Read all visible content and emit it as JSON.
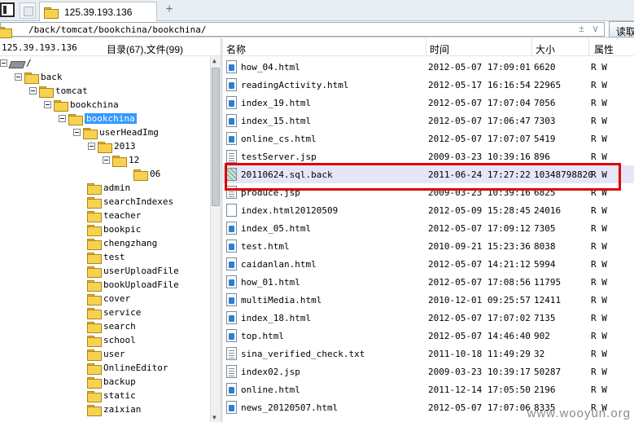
{
  "tab": {
    "title": "125.39.193.136"
  },
  "address": {
    "path": "/back/tomcat/bookchina/bookchina/",
    "read_label": "读取"
  },
  "left_header": {
    "host": "125.39.193.136",
    "counts": "目录(67),文件(99)"
  },
  "tree": [
    {
      "name": "/",
      "kind": "drive"
    },
    {
      "name": "back",
      "kind": "folder"
    },
    {
      "name": "tomcat",
      "kind": "folder"
    },
    {
      "name": "bookchina",
      "kind": "folder"
    },
    {
      "name": "bookchina",
      "kind": "folder",
      "selected": true
    },
    {
      "name": "userHeadImg",
      "kind": "folder"
    },
    {
      "name": "2013",
      "kind": "folder"
    },
    {
      "name": "12",
      "kind": "folder"
    },
    {
      "name": "06",
      "kind": "folder"
    },
    {
      "name": "admin",
      "kind": "folder"
    },
    {
      "name": "searchIndexes",
      "kind": "folder"
    },
    {
      "name": "teacher",
      "kind": "folder"
    },
    {
      "name": "bookpic",
      "kind": "folder"
    },
    {
      "name": "chengzhang",
      "kind": "folder"
    },
    {
      "name": "test",
      "kind": "folder"
    },
    {
      "name": "userUploadFile",
      "kind": "folder"
    },
    {
      "name": "bookUploadFile",
      "kind": "folder"
    },
    {
      "name": "cover",
      "kind": "folder"
    },
    {
      "name": "service",
      "kind": "folder"
    },
    {
      "name": "search",
      "kind": "folder"
    },
    {
      "name": "school",
      "kind": "folder"
    },
    {
      "name": "user",
      "kind": "folder"
    },
    {
      "name": "OnlineEditor",
      "kind": "folder"
    },
    {
      "name": "backup",
      "kind": "folder"
    },
    {
      "name": "static",
      "kind": "folder"
    },
    {
      "name": "zaixian",
      "kind": "folder"
    }
  ],
  "columns": {
    "name": "名称",
    "time": "时间",
    "size": "大小",
    "attr": "属性"
  },
  "files": [
    {
      "name": "how_04.html",
      "time": "2012-05-07 17:09:01",
      "size": "6620",
      "attr": "R W",
      "icon": "doc"
    },
    {
      "name": "readingActivity.html",
      "time": "2012-05-17 16:16:54",
      "size": "22965",
      "attr": "R W",
      "icon": "doc"
    },
    {
      "name": "index_19.html",
      "time": "2012-05-07 17:07:04",
      "size": "7056",
      "attr": "R W",
      "icon": "doc"
    },
    {
      "name": "index_15.html",
      "time": "2012-05-07 17:06:47",
      "size": "7303",
      "attr": "R W",
      "icon": "doc"
    },
    {
      "name": "online_cs.html",
      "time": "2012-05-07 17:07:07",
      "size": "5419",
      "attr": "R W",
      "icon": "doc"
    },
    {
      "name": "testServer.jsp",
      "time": "2009-03-23 10:39:16",
      "size": "896",
      "attr": "R W",
      "icon": "txt"
    },
    {
      "name": "20110624.sql.back",
      "time": "2011-06-24 17:27:22",
      "size": "10348798820",
      "attr": "R W",
      "icon": "bak",
      "highlight": true
    },
    {
      "name": "produce.jsp",
      "time": "2009-03-23 10:39:16",
      "size": "6825",
      "attr": "R W",
      "icon": "txt"
    },
    {
      "name": "index.html20120509",
      "time": "2012-05-09 15:28:45",
      "size": "24016",
      "attr": "R W",
      "icon": "plain"
    },
    {
      "name": "index_05.html",
      "time": "2012-05-07 17:09:12",
      "size": "7305",
      "attr": "R W",
      "icon": "doc"
    },
    {
      "name": "test.html",
      "time": "2010-09-21 15:23:36",
      "size": "8038",
      "attr": "R W",
      "icon": "doc"
    },
    {
      "name": "caidanlan.html",
      "time": "2012-05-07 14:21:12",
      "size": "5994",
      "attr": "R W",
      "icon": "doc"
    },
    {
      "name": "how_01.html",
      "time": "2012-05-07 17:08:56",
      "size": "11795",
      "attr": "R W",
      "icon": "doc"
    },
    {
      "name": "multiMedia.html",
      "time": "2010-12-01 09:25:57",
      "size": "12411",
      "attr": "R W",
      "icon": "doc"
    },
    {
      "name": "index_18.html",
      "time": "2012-05-07 17:07:02",
      "size": "7135",
      "attr": "R W",
      "icon": "doc"
    },
    {
      "name": "top.html",
      "time": "2012-05-07 14:46:40",
      "size": "902",
      "attr": "R W",
      "icon": "doc"
    },
    {
      "name": "sina_verified_check.txt",
      "time": "2011-10-18 11:49:29",
      "size": "32",
      "attr": "R W",
      "icon": "txt"
    },
    {
      "name": "index02.jsp",
      "time": "2009-03-23 10:39:17",
      "size": "50287",
      "attr": "R W",
      "icon": "txt"
    },
    {
      "name": "online.html",
      "time": "2011-12-14 17:05:50",
      "size": "2196",
      "attr": "R W",
      "icon": "doc"
    },
    {
      "name": "news_20120507.html",
      "time": "2012-05-07 17:07:06",
      "size": "8335",
      "attr": "R W",
      "icon": "doc"
    }
  ],
  "watermark": "www.wooyun.org",
  "colors": {
    "selection": "#3399ff",
    "highlight_row": "#e6e6f8",
    "annotation": "#e00000",
    "folder": "#f7d24f"
  }
}
